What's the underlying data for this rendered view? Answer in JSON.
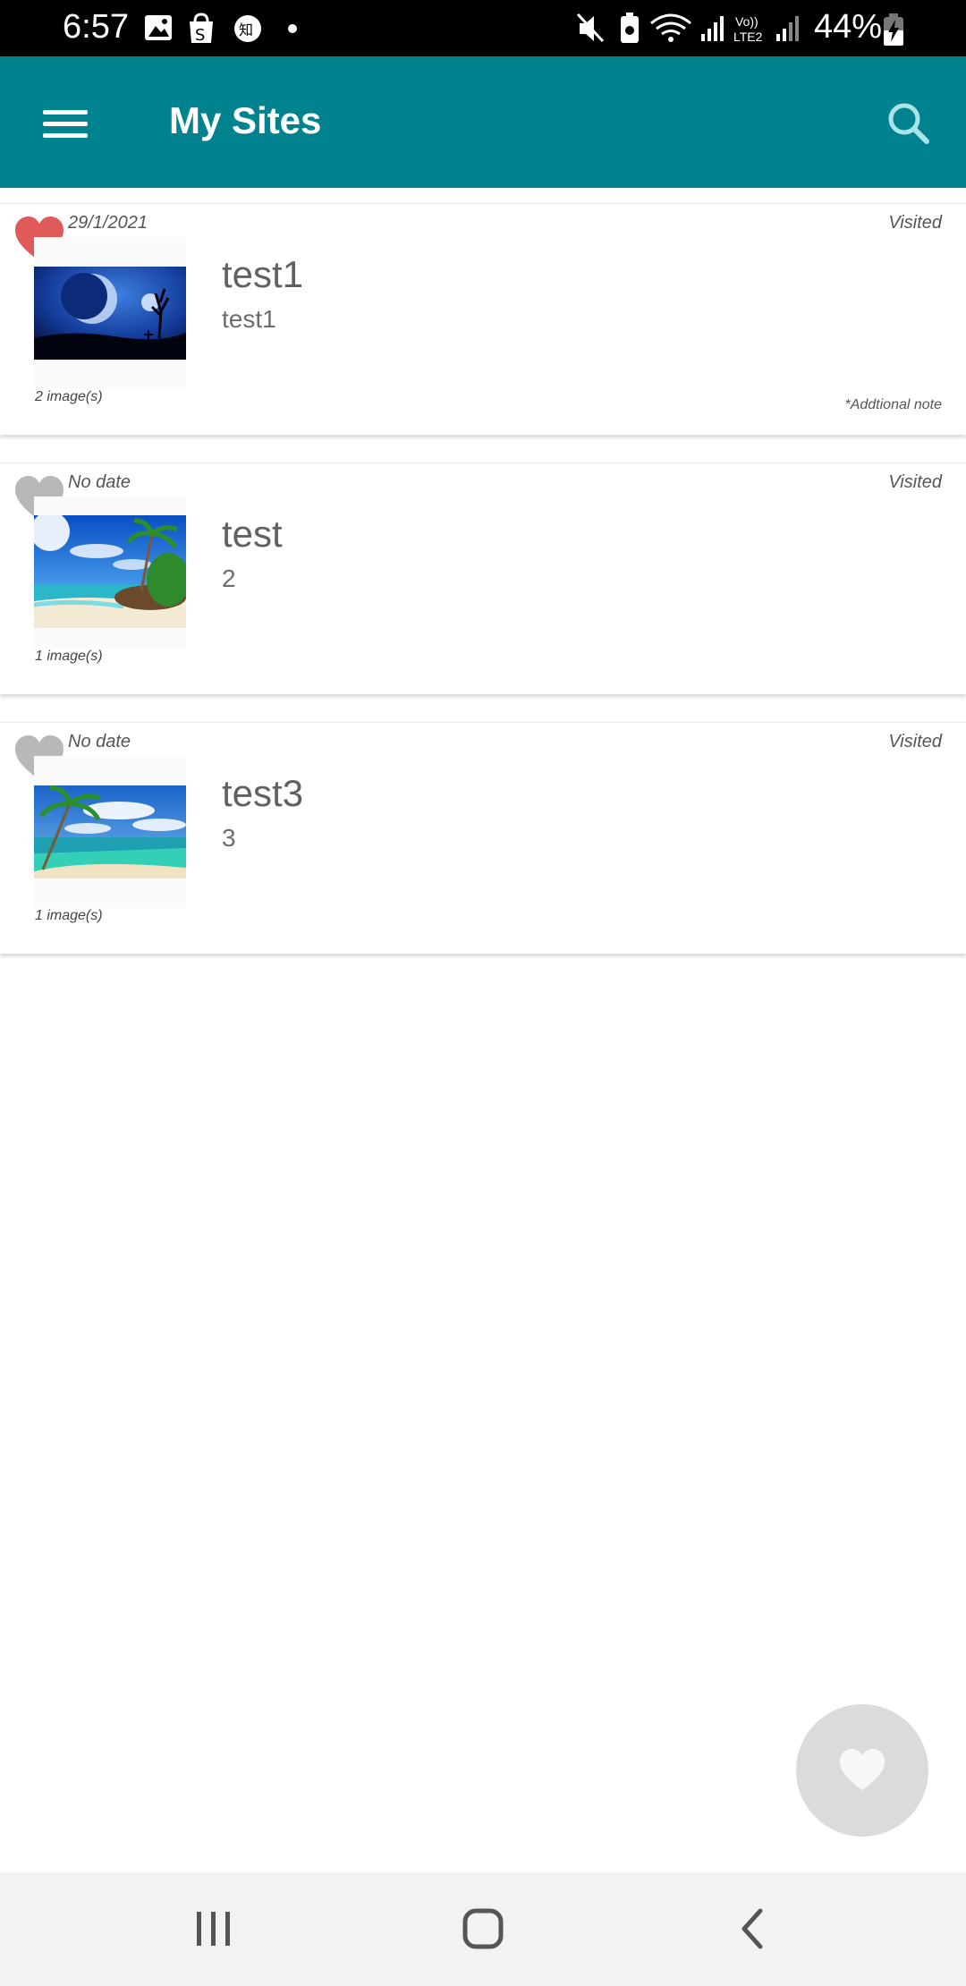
{
  "status_bar": {
    "time": "6:57",
    "battery_percent": "44%",
    "network_label_top": "Vo))",
    "network_label_bottom": "LTE2",
    "notification_icons": [
      "gallery-icon",
      "shop-icon",
      "zhihu-icon",
      "dot-icon"
    ],
    "system_icons": [
      "mute-icon",
      "battery-saver-icon",
      "wifi-icon",
      "signal-icon",
      "signal-icon",
      "battery-charging-icon"
    ]
  },
  "app_bar": {
    "title": "My Sites",
    "color": "#00838f"
  },
  "sites": [
    {
      "favorite": true,
      "heart_color": "#e05a5a",
      "date": "29/1/2021",
      "status": "Visited",
      "title": "test1",
      "subtitle": "test1",
      "image_count": "2 image(s)",
      "note": "*Addtional note",
      "thumbnail": "night-moon-scene"
    },
    {
      "favorite": false,
      "heart_color": "#b8b8b8",
      "date": "No date",
      "status": "Visited",
      "title": "test",
      "subtitle": "2",
      "image_count": "1 image(s)",
      "note": "",
      "thumbnail": "tropical-beach"
    },
    {
      "favorite": false,
      "heart_color": "#b8b8b8",
      "date": "No date",
      "status": "Visited",
      "title": "test3",
      "subtitle": "3",
      "image_count": "1 image(s)",
      "note": "",
      "thumbnail": "palm-lagoon"
    }
  ],
  "fab": {
    "icon": "heart-icon",
    "color": "#dcdada"
  },
  "nav_bar": {
    "buttons": [
      "recents-icon",
      "home-icon",
      "back-icon"
    ]
  }
}
